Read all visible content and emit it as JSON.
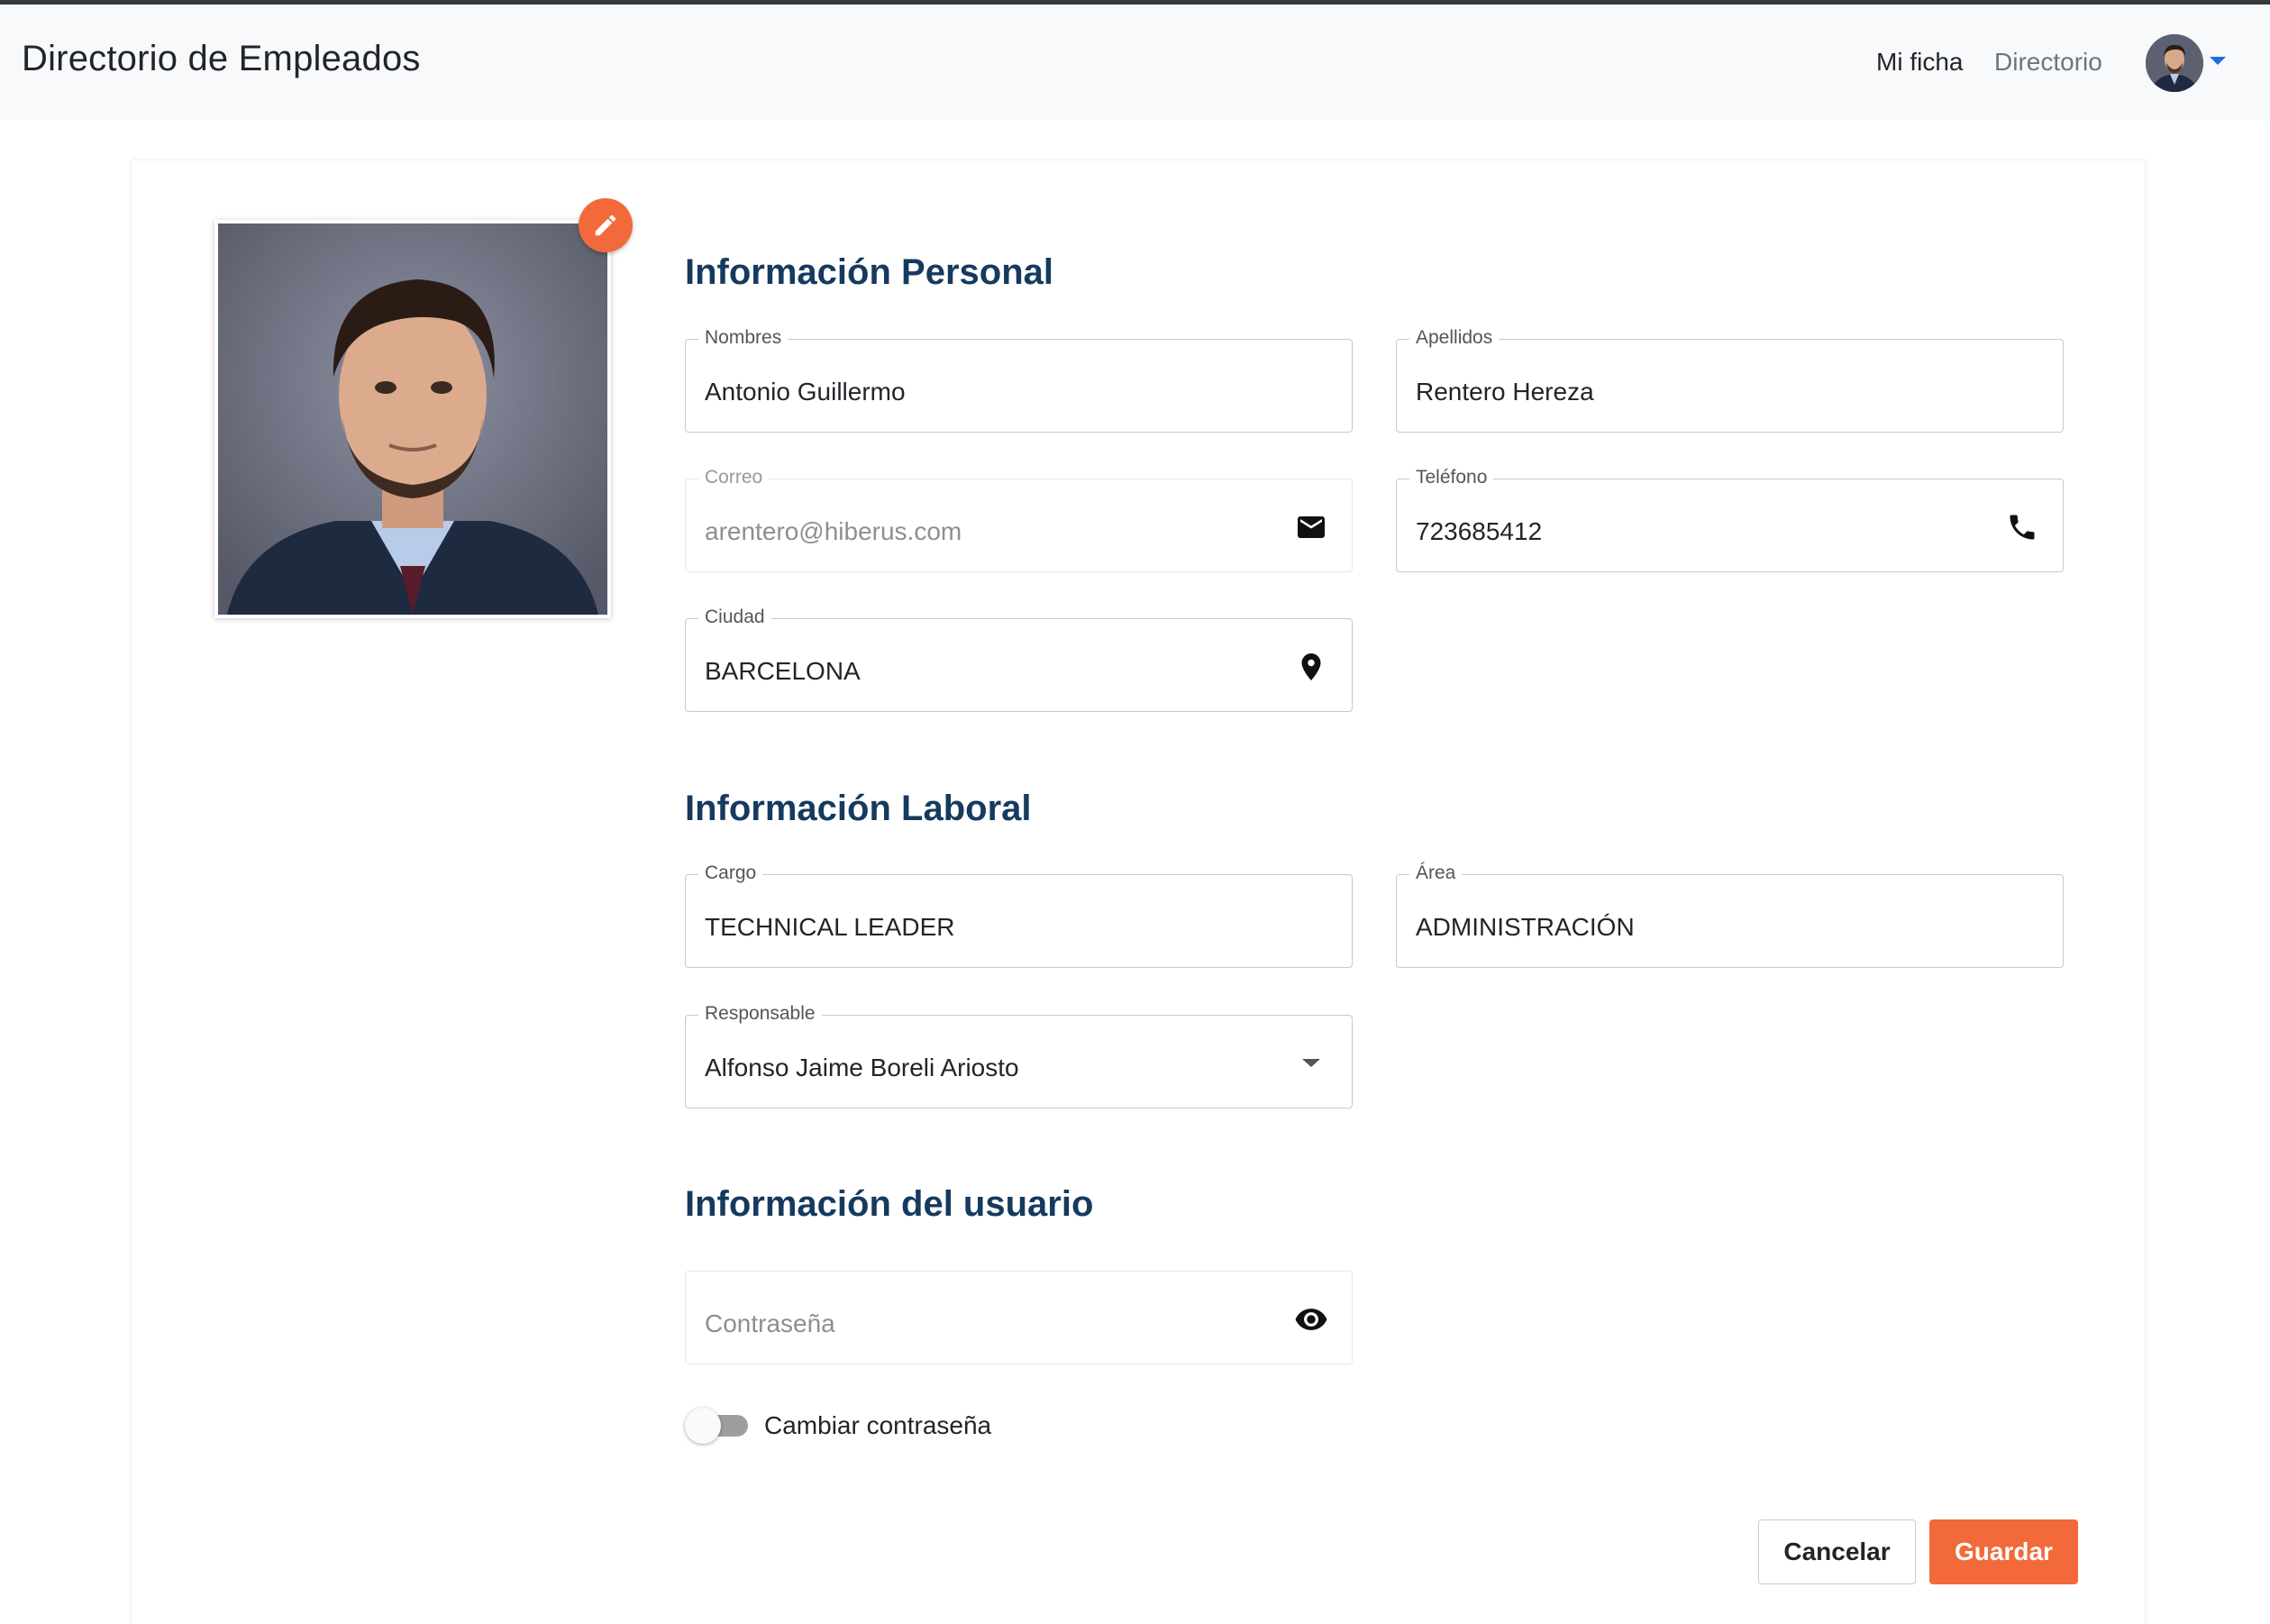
{
  "header": {
    "title": "Directorio de Empleados",
    "nav": {
      "mine": "Mi ficha",
      "directory": "Directorio"
    }
  },
  "sections": {
    "personal": "Información Personal",
    "work": "Información Laboral",
    "user": "Información del usuario"
  },
  "fields": {
    "nombres": {
      "label": "Nombres",
      "value": "Antonio Guillermo"
    },
    "apellidos": {
      "label": "Apellidos",
      "value": "Rentero Hereza"
    },
    "correo": {
      "label": "Correo",
      "value": "arentero@hiberus.com",
      "icon": "mail-icon"
    },
    "telefono": {
      "label": "Teléfono",
      "value": "723685412",
      "icon": "phone-icon"
    },
    "ciudad": {
      "label": "Ciudad",
      "value": "BARCELONA",
      "icon": "location-pin-icon"
    },
    "cargo": {
      "label": "Cargo",
      "value": "TECHNICAL LEADER"
    },
    "area": {
      "label": "Área",
      "value": "ADMINISTRACIÓN"
    },
    "responsable": {
      "label": "Responsable",
      "value": "Alfonso Jaime Boreli Ariosto",
      "icon": "dropdown-arrow-icon"
    },
    "password": {
      "placeholder": "Contraseña",
      "icon": "eye-icon"
    }
  },
  "toggle": {
    "label": "Cambiar contraseña",
    "checked": false
  },
  "buttons": {
    "cancel": "Cancelar",
    "save": "Guardar"
  },
  "colors": {
    "accent": "#f26a3a",
    "heading": "#163a5f",
    "navbar": "#f8f9fa",
    "caret": "#1e6fe0"
  }
}
